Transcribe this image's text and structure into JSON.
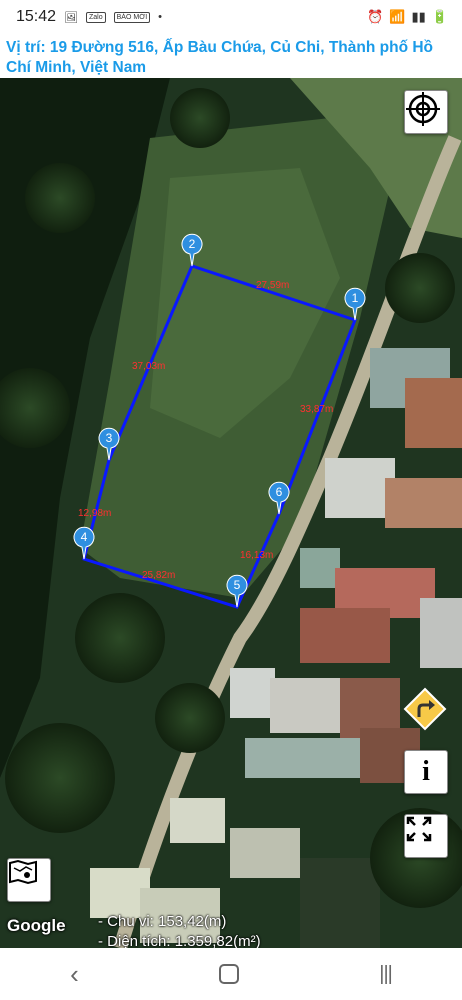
{
  "status_bar": {
    "time": "15:42",
    "zalo": "Zalo",
    "bao": "BÁO MỚI"
  },
  "header": {
    "location_text": "Vị trí: 19 Đường 516, Ấp Bàu Chứa, Củ Chi, Thành phố Hồ Chí Minh, Việt Nam"
  },
  "map": {
    "markers": [
      "1",
      "2",
      "3",
      "4",
      "5",
      "6"
    ],
    "edge_labels": [
      "27,59m",
      "37,03m",
      "33,87m",
      "12,98m",
      "16,13m",
      "25,82m"
    ],
    "attribution": "Google",
    "polygon_color": "#0a18ff",
    "label_color": "#ff3030",
    "marker_color": "#2f8fe0"
  },
  "stats": {
    "perimeter": "- Chu vi: 153,42(m)",
    "area": "- Diện tích: 1.359,82(m²)"
  }
}
